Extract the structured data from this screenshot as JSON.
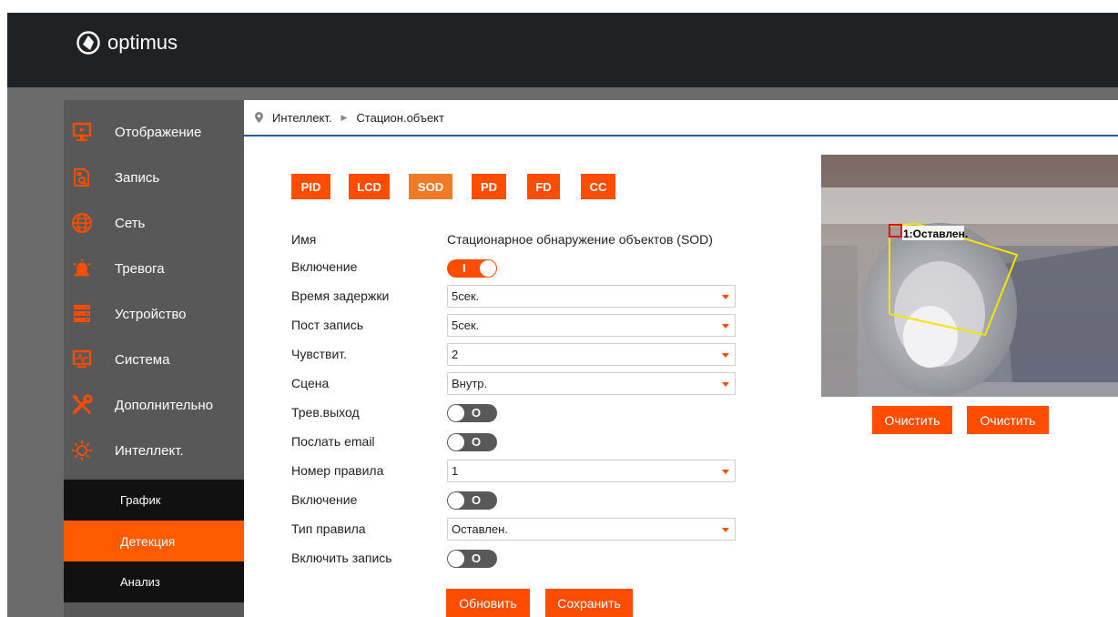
{
  "app": {
    "logo_text": "optimus"
  },
  "sidebar": {
    "items": [
      {
        "label": "Отображение",
        "icon": "monitor-play-icon"
      },
      {
        "label": "Запись",
        "icon": "record-search-icon"
      },
      {
        "label": "Сеть",
        "icon": "globe-icon"
      },
      {
        "label": "Тревога",
        "icon": "alarm-bell-icon"
      },
      {
        "label": "Устройство",
        "icon": "server-icon"
      },
      {
        "label": "Система",
        "icon": "system-monitor-icon"
      },
      {
        "label": "Дополнительно",
        "icon": "tools-icon"
      },
      {
        "label": "Интеллект.",
        "icon": "intelligence-icon"
      }
    ],
    "subitems": [
      {
        "label": "График",
        "active": false
      },
      {
        "label": "Детекция",
        "active": true
      },
      {
        "label": "Анализ",
        "active": false
      }
    ]
  },
  "breadcrumb": {
    "section": "Интеллект.",
    "page": "Стацион.объект"
  },
  "tabs": [
    "PID",
    "LCD",
    "SOD",
    "PD",
    "FD",
    "CC"
  ],
  "selected_tab": "SOD",
  "form": {
    "name_label": "Имя",
    "name_value": "Стационарное обнаружение объектов (SOD)",
    "enable_label": "Включение",
    "enable_state": "on",
    "delay_label": "Время задержки",
    "delay_value": "5сек.",
    "post_rec_label": "Пост запись",
    "post_rec_value": "5сек.",
    "sensitivity_label": "Чувствит.",
    "sensitivity_value": "2",
    "scene_label": "Сцена",
    "scene_value": "Внутр.",
    "alarm_out_label": "Трев.выход",
    "alarm_out_state": "off",
    "email_label": "Послать email",
    "email_state": "off",
    "rule_no_label": "Номер правила",
    "rule_no_value": "1",
    "rule_enable_label": "Включение",
    "rule_enable_state": "off",
    "rule_type_label": "Тип правила",
    "rule_type_value": "Оставлен.",
    "record_label": "Включить запись",
    "record_state": "off",
    "toggle_on_mark": "I",
    "toggle_off_mark": "O"
  },
  "buttons": {
    "refresh": "Обновить",
    "save": "Сохранить",
    "clear1": "Очистить",
    "clear2": "Очистить"
  },
  "preview": {
    "rule_label": "1:Оставлен."
  },
  "colors": {
    "accent": "#ff4d00",
    "accent_selected": "#f07a26",
    "topbar": "#1f2225",
    "sidebar": "#585858",
    "submenu": "#111111",
    "breadcrumb_line": "#2a5d9e",
    "zone": "#f2e600"
  }
}
